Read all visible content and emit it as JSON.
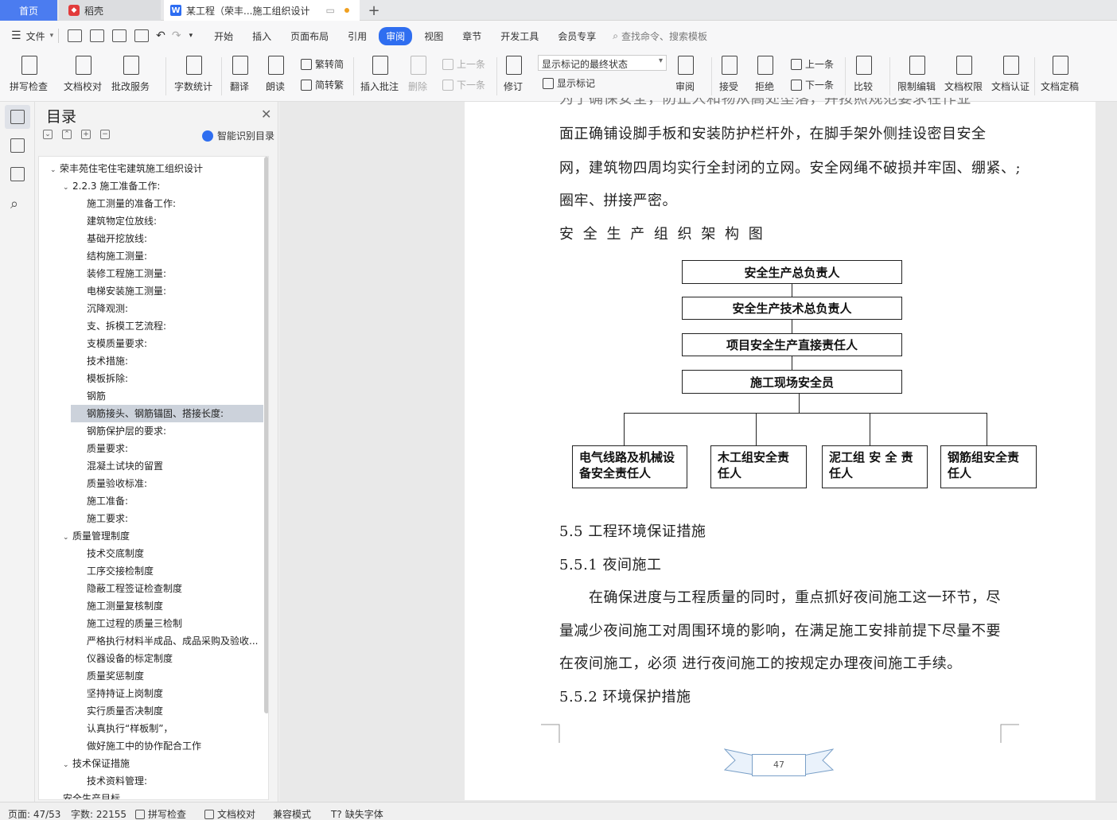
{
  "tabs": {
    "home": "首页",
    "daoke": "稻壳",
    "doc": "某工程（荣丰...施工组织设计",
    "add": "+"
  },
  "menu": {
    "file": "文件",
    "items": [
      "开始",
      "插入",
      "页面布局",
      "引用",
      "审阅",
      "视图",
      "章节",
      "开发工具",
      "会员专享"
    ],
    "active": "审阅",
    "search": "查找命令、搜索模板"
  },
  "ribbon": {
    "spell": "拼写检查",
    "proof": "文档校对",
    "batch": "批改服务",
    "wordcount": "字数统计",
    "translate": "翻译",
    "read": "朗读",
    "to_trad": "繁转简",
    "to_simp": "简转繁",
    "insert_comment": "插入批注",
    "delete": "删除",
    "prev_comment": "上一条",
    "next_comment": "下一条",
    "revise": "修订",
    "markup_select": "显示标记的最终状态",
    "show_markup": "显示标记",
    "review": "审阅",
    "accept": "接受",
    "reject": "拒绝",
    "prev_change": "上一条",
    "next_change": "下一条",
    "compare": "比较",
    "restrict": "限制编辑",
    "permission": "文档权限",
    "cert": "文档认证",
    "finalize": "文档定稿"
  },
  "toc": {
    "title": "目录",
    "smart": "智能识别目录",
    "items": [
      {
        "label": "荣丰苑住宅住宅建筑施工组织设计",
        "level": 0,
        "expand": true
      },
      {
        "label": "2.2.3 施工准备工作:",
        "level": 1,
        "expand": true
      },
      {
        "label": "施工测量的准备工作:",
        "level": 2
      },
      {
        "label": "建筑物定位放线:",
        "level": 2
      },
      {
        "label": "基础开挖放线:",
        "level": 2
      },
      {
        "label": "结构施工测量:",
        "level": 2
      },
      {
        "label": "装修工程施工测量:",
        "level": 2
      },
      {
        "label": "电梯安装施工测量:",
        "level": 2
      },
      {
        "label": "沉降观测:",
        "level": 2
      },
      {
        "label": "支、拆模工艺流程:",
        "level": 2
      },
      {
        "label": "支模质量要求:",
        "level": 2
      },
      {
        "label": "技术措施:",
        "level": 2
      },
      {
        "label": "模板拆除:",
        "level": 2
      },
      {
        "label": "钢筋",
        "level": 2
      },
      {
        "label": "钢筋接头、钢筋锚固、搭接长度:",
        "level": 2,
        "selected": true
      },
      {
        "label": "钢筋保护层的要求:",
        "level": 2
      },
      {
        "label": "质量要求:",
        "level": 2
      },
      {
        "label": "混凝土试块的留置",
        "level": 2
      },
      {
        "label": "质量验收标准:",
        "level": 2
      },
      {
        "label": "施工准备:",
        "level": 2
      },
      {
        "label": "施工要求:",
        "level": 2
      },
      {
        "label": "质量管理制度",
        "level": 1,
        "expand": true
      },
      {
        "label": "技术交底制度",
        "level": 2
      },
      {
        "label": "工序交接检制度",
        "level": 2
      },
      {
        "label": "隐蔽工程签证检查制度",
        "level": 2
      },
      {
        "label": "施工测量复核制度",
        "level": 2
      },
      {
        "label": "施工过程的质量三检制",
        "level": 2
      },
      {
        "label": "严格执行材料半成品、成品采购及验收...",
        "level": 2
      },
      {
        "label": "仪器设备的标定制度",
        "level": 2
      },
      {
        "label": "质量奖惩制度",
        "level": 2
      },
      {
        "label": "坚持持证上岗制度",
        "level": 2
      },
      {
        "label": "实行质量否决制度",
        "level": 2
      },
      {
        "label": "认真执行“样板制”，",
        "level": 2
      },
      {
        "label": "做好施工中的协作配合工作",
        "level": 2
      },
      {
        "label": "技术保证措施",
        "level": 1,
        "expand": true
      },
      {
        "label": "技术资料管理:",
        "level": 2
      },
      {
        "label": "安全生产目标",
        "level": 1
      }
    ]
  },
  "document": {
    "line_top": "为了确保安全，防止人和物从高处坠落，并按照规范要求在作业",
    "line1": "面正确铺设脚手板和安装防护栏杆外，在脚手架外侧挂设密目安全",
    "line2": "网，建筑物四周均实行全封闭的立网。安全网绳不破损并牢固、绷紧、;",
    "line3": "圈牢、拼接严密。",
    "chart_heading": "安 全 生 产 组 织 架 构 图",
    "org": {
      "top": "安全生产总负责人",
      "tech": "安全生产技术总负责人",
      "project": "项目安全生产直接责任人",
      "site": "施工现场安全员",
      "b1": "电气线路及机械设备安全责任人",
      "b2": "木工组安全责任人",
      "b3": "泥工组 安 全 责任人",
      "b4": "钢筋组安全责任人"
    },
    "h55": "5.5 工程环境保证措施",
    "h551": "5.5.1 夜间施工",
    "p1": "在确保进度与工程质量的同时，重点抓好夜间施工这一环节，尽",
    "p2": "量减少夜间施工对周围环境的影响，在满足施工安排前提下尽量不要",
    "p3": "在夜间施工，必须 进行夜间施工的按规定办理夜间施工手续。",
    "h552": "5.5.2 环境保护措施",
    "page_number": "47"
  },
  "status": {
    "page": "页面: 47/53",
    "words": "字数: 22155",
    "spell": "拼写检查",
    "proof": "文档校对",
    "compat": "兼容模式",
    "missing_font": "缺失字体"
  }
}
